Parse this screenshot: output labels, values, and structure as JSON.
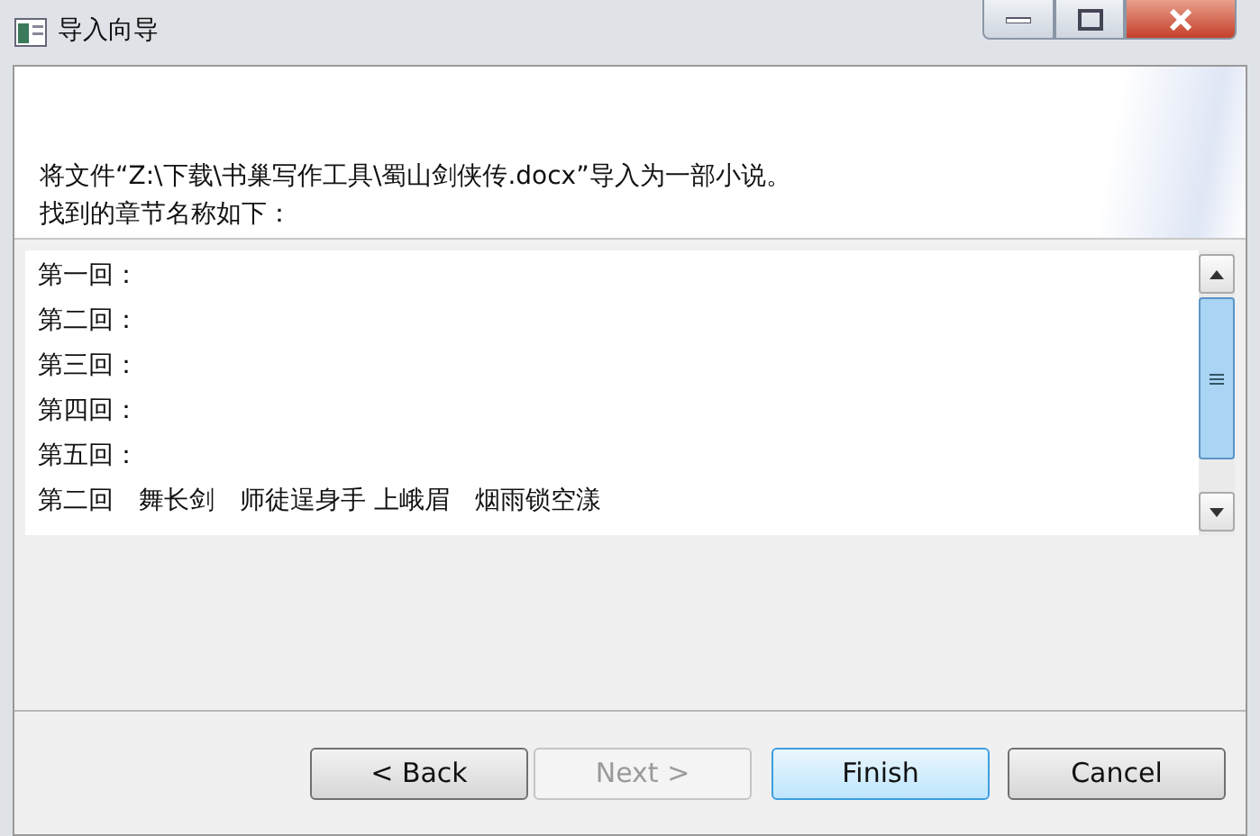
{
  "window": {
    "title": "导入向导"
  },
  "intro": [
    "将文件“Z:\\下载\\书巢写作工具\\蜀山剑侠传.docx”导入为一部小说。",
    "找到的章节名称如下："
  ],
  "chapters": [
    "第一回：",
    "第二回：",
    "第三回：",
    "第四回：",
    "第五回：",
    "第二回　舞长剑　师徒逞身手 上峨眉　烟雨锁空漾"
  ],
  "buttons": [
    {
      "label": "< Back",
      "disabled": false,
      "default": false
    },
    {
      "label": "Next >",
      "disabled": true,
      "default": false
    },
    {
      "label": "Finish",
      "disabled": false,
      "default": true
    },
    {
      "label": "Cancel",
      "disabled": false,
      "default": false
    }
  ]
}
